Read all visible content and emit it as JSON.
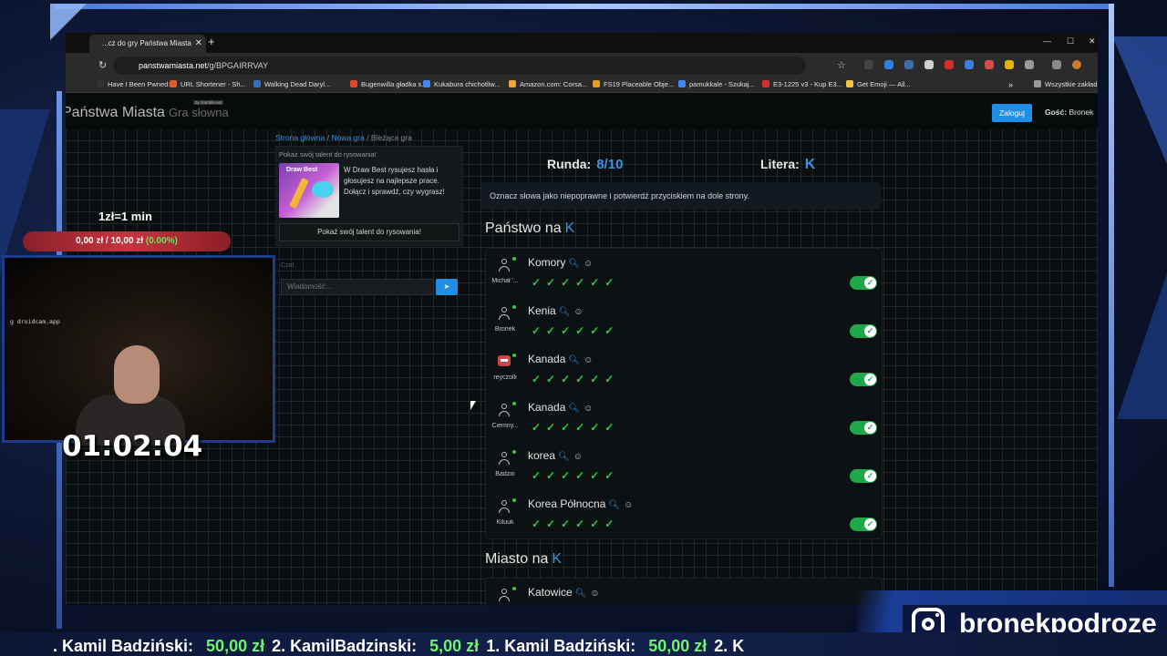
{
  "browser": {
    "tab_title": "...cz do gry Państwa Miasta",
    "tab_close": "✕",
    "new_tab": "+",
    "url_host": "panstwamiasta.net",
    "url_path": "/g/BPGAIRRVAY",
    "bookmarks": [
      {
        "label": "Have I Been Pwned:...",
        "color": "#333333"
      },
      {
        "label": "URL Shortener - Sh...",
        "color": "#e05a2b"
      },
      {
        "label": "Walking Dead Daryl...",
        "color": "#3b6cc4"
      },
      {
        "label": "Bugenwilla gładka s...",
        "color": "#e04a2b"
      },
      {
        "label": "Kukabura chichotliw...",
        "color": "#4285f4"
      },
      {
        "label": "Amazon.com: Corsa...",
        "color": "#f2a33a"
      },
      {
        "label": "FS19 Placeable Obje...",
        "color": "#e0a020"
      },
      {
        "label": "pamukkale - Szukaj...",
        "color": "#4285f4"
      },
      {
        "label": "E3-1225 v3 - Kup E3...",
        "color": "#d83030"
      },
      {
        "label": "Get Emoji — All...",
        "color": "#f5c542"
      }
    ],
    "bookmarks_more": "»",
    "all_bookmarks": "Wszystkie zakład"
  },
  "site": {
    "logo": "Państwa Miasta",
    "logo_sub": "Gra słowna",
    "logo_tag": "by Gamble.net",
    "login_label": "Zaloguj",
    "guest_label": "Gość:",
    "guest_name": "Bronek"
  },
  "breadcrumb": {
    "home": "Strona główna",
    "new_game": "Nowa gra",
    "current": "Bieżąca gra"
  },
  "promo": {
    "title": "Pokaż swój talent do rysowania!",
    "image_title": "Draw Best",
    "text": "W Draw Best rysujesz hasła i głosujesz na najlepsze prace. Dołącz i sprawdź, czy wygrasz!",
    "button": "Pokaż swój talent do rysowania!"
  },
  "chat": {
    "label": "Czat",
    "placeholder": "Wiadomość..."
  },
  "game": {
    "round_label": "Runda:",
    "round_value": "8/10",
    "letter_label": "Litera:",
    "letter_value": "K",
    "info": "Oznacz słowa jako niepoprawne i potwierdź przyciskiem na dole strony.",
    "section1_title": "Państwo na",
    "section1_letter": "K",
    "section2_title": "Miasto na",
    "section2_letter": "K",
    "checks": "✓✓✓✓✓✓",
    "answers": [
      {
        "user": "Michał '...",
        "word": "Komory",
        "robot": false
      },
      {
        "user": "Bronek",
        "word": "Kenia",
        "robot": false
      },
      {
        "user": "reyczolli",
        "word": "Kanada",
        "robot": true
      },
      {
        "user": "Ciemny...",
        "word": "Kanada",
        "robot": false
      },
      {
        "user": "Badzio",
        "word": "korea",
        "robot": false
      },
      {
        "user": "Kiluuk",
        "word": "Korea Północna",
        "robot": false
      }
    ],
    "city_answers": [
      {
        "user": "",
        "word": "Katowice"
      }
    ]
  },
  "stream": {
    "rate": "1zł=1 min",
    "donation_current": "0,00 zł",
    "donation_sep": "/",
    "donation_goal": "10,00 zł",
    "donation_pct": "(0.00%)",
    "cam_watermark": "g droidcam.app",
    "timer": "01:02:04",
    "ticker": [
      {
        "name": ". Kamil Badziński:",
        "amount": "50,00 zł"
      },
      {
        "name": "2. KamilBadzinski:",
        "amount": "5,00 zł"
      },
      {
        "name": "1. Kamil Badziński:",
        "amount": "50,00 zł"
      },
      {
        "name": "2. K",
        "amount": ""
      }
    ],
    "instagram_handle": "bronekpodroze"
  }
}
